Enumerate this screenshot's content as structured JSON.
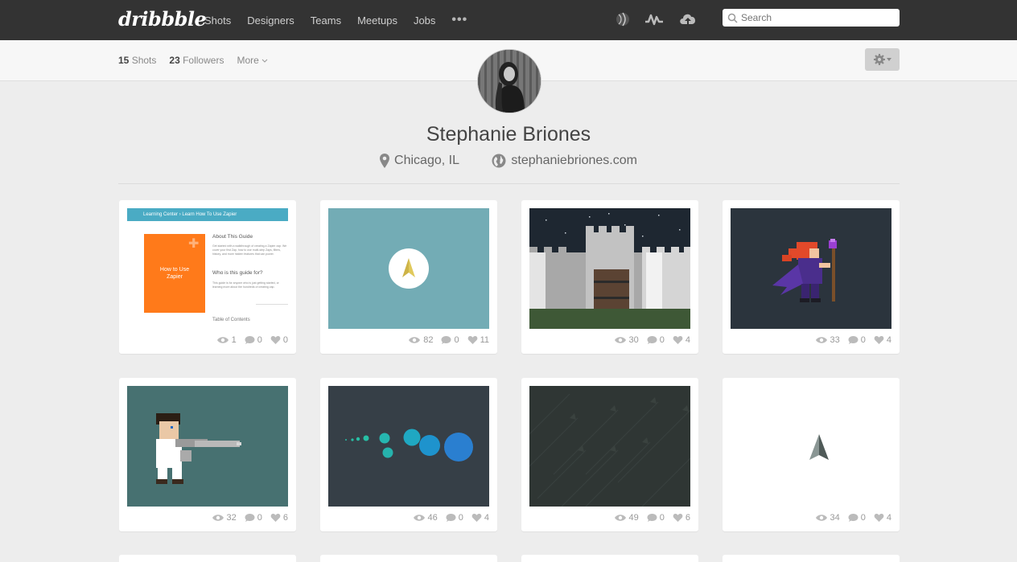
{
  "brand": {
    "logo_text": "dribbble"
  },
  "nav": {
    "links": [
      "Shots",
      "Designers",
      "Teams",
      "Meetups",
      "Jobs"
    ],
    "more_label": "•••",
    "icons": [
      "ball-icon",
      "activity-icon",
      "upload-cloud-icon"
    ]
  },
  "search": {
    "placeholder": "Search"
  },
  "subbar": {
    "shots_count": "15",
    "shots_label": "Shots",
    "followers_count": "23",
    "followers_label": "Followers",
    "more_label": "More"
  },
  "profile": {
    "name": "Stephanie Briones",
    "location": "Chicago, IL",
    "website": "stephaniebriones.com"
  },
  "shots": [
    {
      "thumb": "zapier-guide",
      "views": "1",
      "comments": "0",
      "likes": "0",
      "guide": {
        "breadcrumb": "Learning Center › Learn How To Use Zapier",
        "cover_title": "How to Use Zapier",
        "about": "About This Guide",
        "about_text": "Get started with a walkthrough of creating a Zapier zap. We cover your first Zap, how to use multi-step Zaps, filters, history, and more hidden features that can power.",
        "who": "Who is this guide for?",
        "who_text": "This guide is for anyone who is just getting started, or learning more about the hundreds of creating zap.",
        "toc": "Table of Contents"
      }
    },
    {
      "thumb": "teal-arrow",
      "views": "82",
      "comments": "0",
      "likes": "11"
    },
    {
      "thumb": "castle",
      "views": "30",
      "comments": "0",
      "likes": "4"
    },
    {
      "thumb": "wizard",
      "views": "33",
      "comments": "0",
      "likes": "4"
    },
    {
      "thumb": "pixel-boy",
      "views": "32",
      "comments": "0",
      "likes": "6"
    },
    {
      "thumb": "bubbles",
      "views": "46",
      "comments": "0",
      "likes": "4"
    },
    {
      "thumb": "arrow-pattern",
      "views": "49",
      "comments": "0",
      "likes": "6"
    },
    {
      "thumb": "grey-arrow",
      "views": "34",
      "comments": "0",
      "likes": "4"
    }
  ],
  "colors": {
    "nav_bg": "#333333",
    "page_bg": "#ededed",
    "accent_pink": "#ea4c89"
  }
}
